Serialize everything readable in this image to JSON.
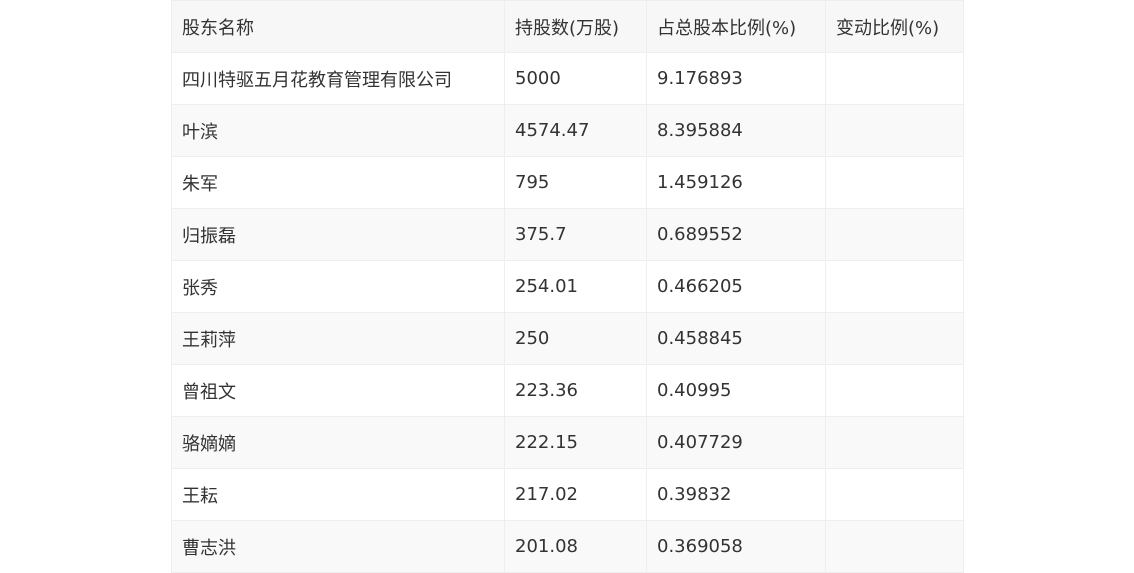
{
  "table": {
    "headers": [
      "股东名称",
      "持股数(万股)",
      "占总股本比例(%)",
      "变动比例(%)"
    ],
    "rows": [
      [
        "四川特驱五月花教育管理有限公司",
        "5000",
        "9.176893",
        ""
      ],
      [
        "叶滨",
        "4574.47",
        "8.395884",
        ""
      ],
      [
        "朱军",
        "795",
        "1.459126",
        ""
      ],
      [
        "归振磊",
        "375.7",
        "0.689552",
        ""
      ],
      [
        "张秀",
        "254.01",
        "0.466205",
        ""
      ],
      [
        "王莉萍",
        "250",
        "0.458845",
        ""
      ],
      [
        "曾祖文",
        "223.36",
        "0.40995",
        ""
      ],
      [
        "骆嫡嫡",
        "222.15",
        "0.407729",
        ""
      ],
      [
        "王耘",
        "217.02",
        "0.39832",
        ""
      ],
      [
        "曹志洪",
        "201.08",
        "0.369058",
        ""
      ]
    ]
  }
}
